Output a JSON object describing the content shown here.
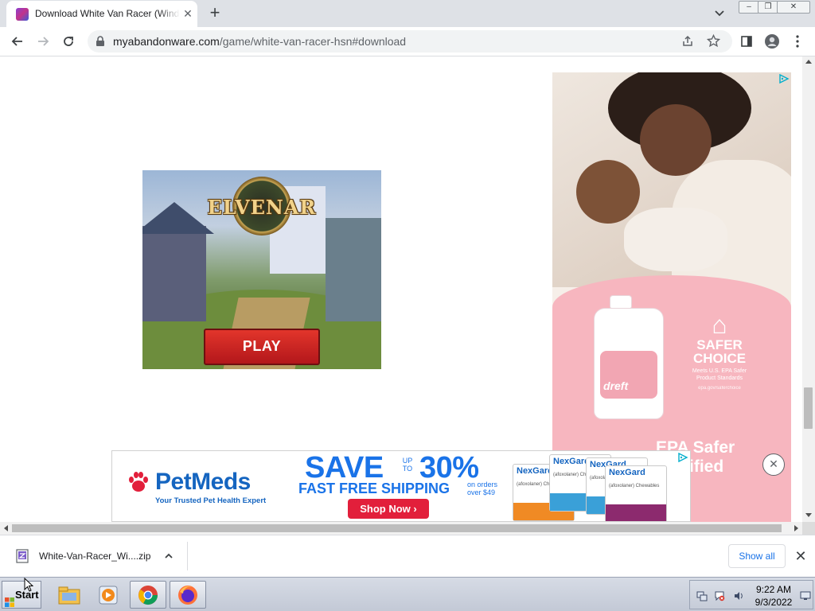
{
  "browser": {
    "tab": {
      "title": "Download White Van Racer (Windows)",
      "close_glyph": "✕"
    },
    "new_tab_glyph": "+",
    "window_controls": {
      "minimize": "–",
      "restore": "❐",
      "close": "✕"
    },
    "url": {
      "host": "myabandonware.com",
      "path": "/game/white-van-racer-hsn#download"
    },
    "icons": {
      "back": "back-arrow-icon",
      "forward": "forward-arrow-icon",
      "reload": "reload-icon",
      "lock": "lock-icon",
      "share": "share-icon",
      "bookmark": "star-icon",
      "sidepanel": "side-panel-icon",
      "profile": "profile-icon",
      "menu": "kebab-menu-icon"
    }
  },
  "ads": {
    "elvenar": {
      "logo": "ELVENAR",
      "play_label": "PLAY"
    },
    "dreft": {
      "brand": "dreft",
      "seal_title_1": "SAFER",
      "seal_title_2": "CHOICE",
      "seal_sub": "Meets U.S. EPA Safer Product Standards",
      "seal_url": "epa.gov/saferchoice",
      "headline": "EPA Safer Certified"
    },
    "close_glyph": "✕",
    "petmeds": {
      "brand": "PetMeds",
      "tagline": "Your Trusted Pet Health Expert",
      "save": "SAVE",
      "up_to": "UP TO",
      "percent": "30%",
      "shipping": "FAST FREE SHIPPING",
      "orders": "on orders over $49",
      "shop_now": "Shop Now ›",
      "product_name": "NexGard",
      "product_sub": "(afoxolaner) Chewables"
    },
    "colors": {
      "petmeds_blue": "#1a73e8",
      "petmeds_red": "#e21f3b",
      "dreft_pink": "#f7b6bf",
      "elvenar_play_red": "#c8202a"
    }
  },
  "download_bar": {
    "file_name": "White-Van-Racer_Wi....zip",
    "show_all": "Show all",
    "close_glyph": "✕"
  },
  "taskbar": {
    "start_label": "Start",
    "apps": [
      "file-explorer-icon",
      "media-player-icon",
      "chrome-icon",
      "firefox-icon"
    ],
    "clock_time": "9:22 AM",
    "clock_date": "9/3/2022"
  }
}
